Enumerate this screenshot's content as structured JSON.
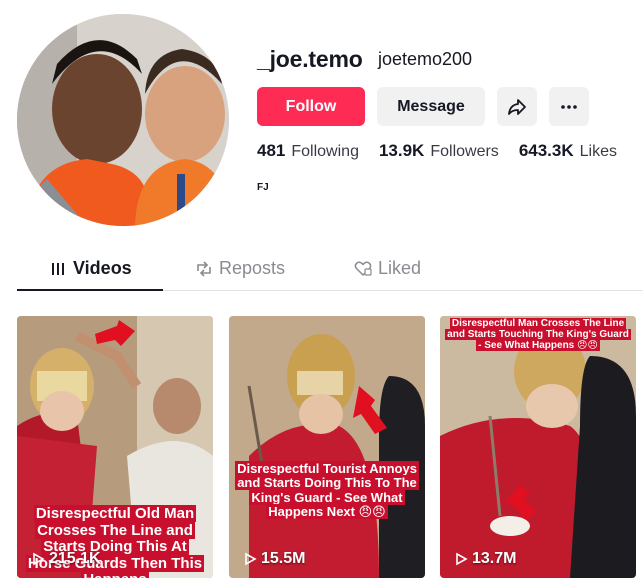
{
  "profile": {
    "username": "_joe.temo",
    "nickname": "joetemo200",
    "bio": "FJ"
  },
  "actions": {
    "follow_label": "Follow",
    "message_label": "Message"
  },
  "stats": {
    "following_count": "481",
    "following_label": "Following",
    "followers_count": "13.9K",
    "followers_label": "Followers",
    "likes_count": "643.3K",
    "likes_label": "Likes"
  },
  "tabs": [
    {
      "label": "Videos",
      "active": true
    },
    {
      "label": "Reposts",
      "active": false
    },
    {
      "label": "Liked",
      "active": false
    }
  ],
  "videos": [
    {
      "caption": "Disrespectful Old Man Crosses The Line and Starts Doing This At Horse Guards Then This Happens",
      "views": "215.1K"
    },
    {
      "caption": "Disrespectful Tourist Annoys and Starts Doing This To The King's Guard - See What Happens Next 😠😠",
      "views": "15.5M"
    },
    {
      "caption": "Disrespectful Man Crosses The Line and Starts Touching The King's Guard - See What Happens 😠😠",
      "views": "13.7M"
    }
  ],
  "colors": {
    "accent": "#fe2c55",
    "caption_bg": "#c8102e"
  }
}
